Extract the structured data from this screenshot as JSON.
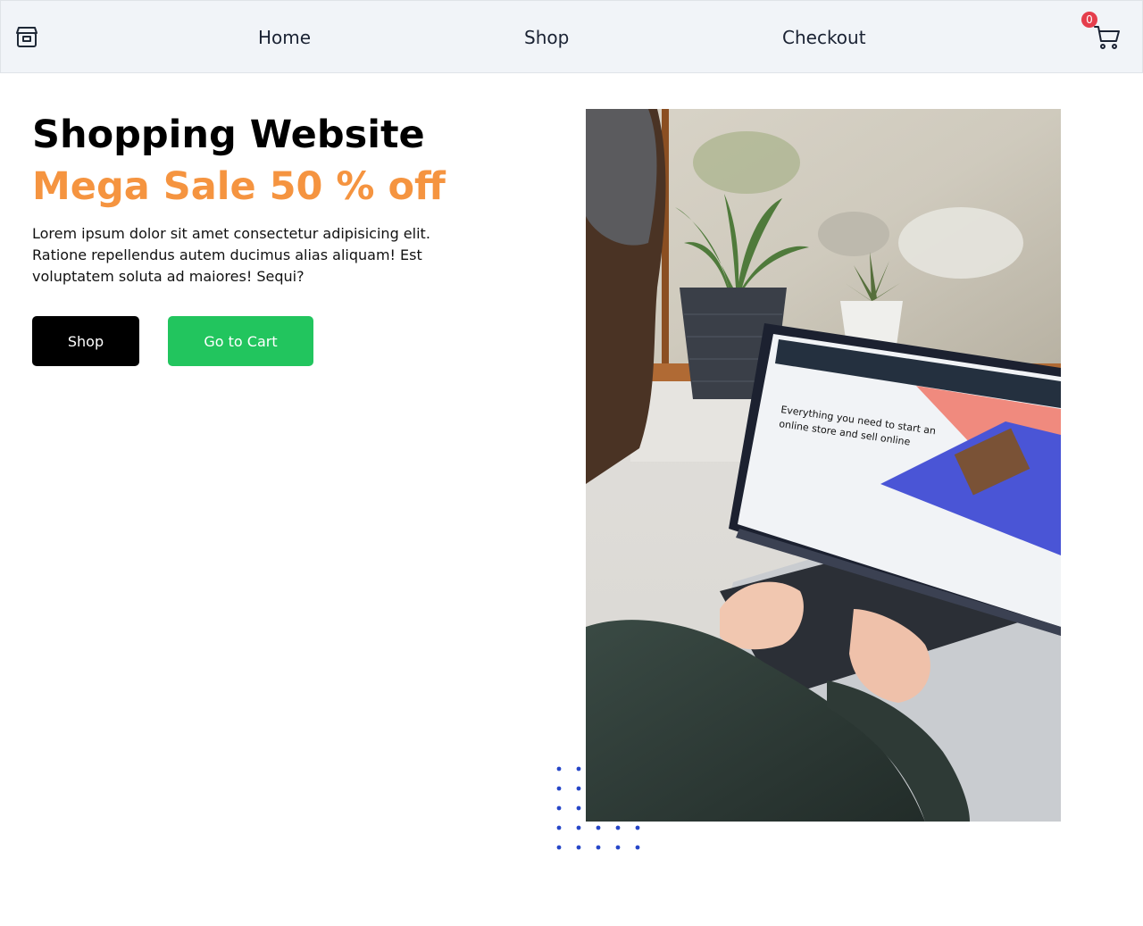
{
  "nav": {
    "home": "Home",
    "shop": "Shop",
    "checkout": "Checkout",
    "cart_count": "0"
  },
  "hero": {
    "title": "Shopping Website",
    "sale": "Mega Sale 50 % off",
    "description": "Lorem ipsum dolor sit amet consectetur adipisicing elit. Ratione repellendus autem ducimus alias aliquam! Est voluptatem soluta ad maiores! Sequi?",
    "shop_button": "Shop",
    "cart_button": "Go to Cart"
  },
  "colors": {
    "accent": "#f59440",
    "primary_button": "#000000",
    "secondary_button": "#22c55e",
    "badge": "#e53e4c",
    "navbar": "#f1f4f8",
    "dots": "#2747c8"
  },
  "icons": [
    "store-icon",
    "cart-icon"
  ]
}
